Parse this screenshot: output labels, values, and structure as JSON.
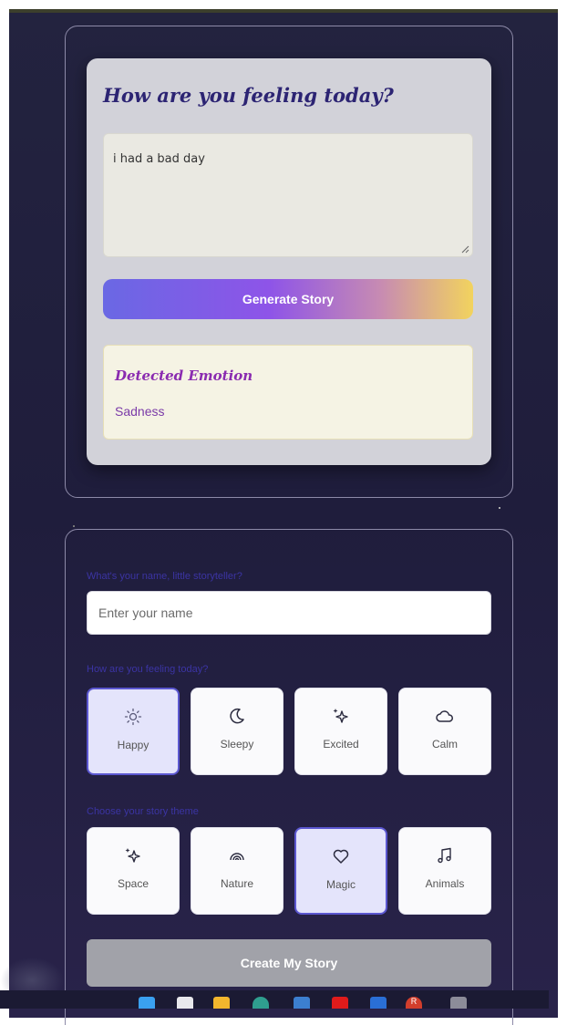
{
  "feeling_card": {
    "title": "How are you feeling today?",
    "input_value": "i had a bad day",
    "generate_label": "Generate Story",
    "emotion_title": "Detected Emotion",
    "emotion_value": "Sadness"
  },
  "story_form": {
    "name_label": "What's your name, little storyteller?",
    "name_placeholder": "Enter your name",
    "mood_label": "How are you feeling today?",
    "moods": [
      {
        "label": "Happy",
        "icon": "sun-icon",
        "selected": true
      },
      {
        "label": "Sleepy",
        "icon": "moon-icon",
        "selected": false
      },
      {
        "label": "Excited",
        "icon": "sparkles-icon",
        "selected": false
      },
      {
        "label": "Calm",
        "icon": "cloud-icon",
        "selected": false
      }
    ],
    "theme_label": "Choose your story theme",
    "themes": [
      {
        "label": "Space",
        "icon": "sparkles-icon",
        "selected": false
      },
      {
        "label": "Nature",
        "icon": "rainbow-icon",
        "selected": false
      },
      {
        "label": "Magic",
        "icon": "heart-icon",
        "selected": true
      },
      {
        "label": "Animals",
        "icon": "music-note-icon",
        "selected": false
      }
    ],
    "create_label": "Create My Story"
  },
  "taskbar": {
    "icons": [
      "windows-start-icon",
      "file-icon",
      "folder-icon",
      "edge-browser-icon",
      "store-icon",
      "youtube-icon",
      "app-icon",
      "chrome-profile-icon",
      "settings-gear-icon"
    ],
    "profile_initial": "R"
  },
  "colors": {
    "background": "#1f1d3c",
    "accent": "#5b57d0",
    "title": "#2c2473",
    "emotion": "#8a2bb0",
    "gradient": [
      "#6a68e4",
      "#8e54e8",
      "#f2d35e"
    ]
  }
}
